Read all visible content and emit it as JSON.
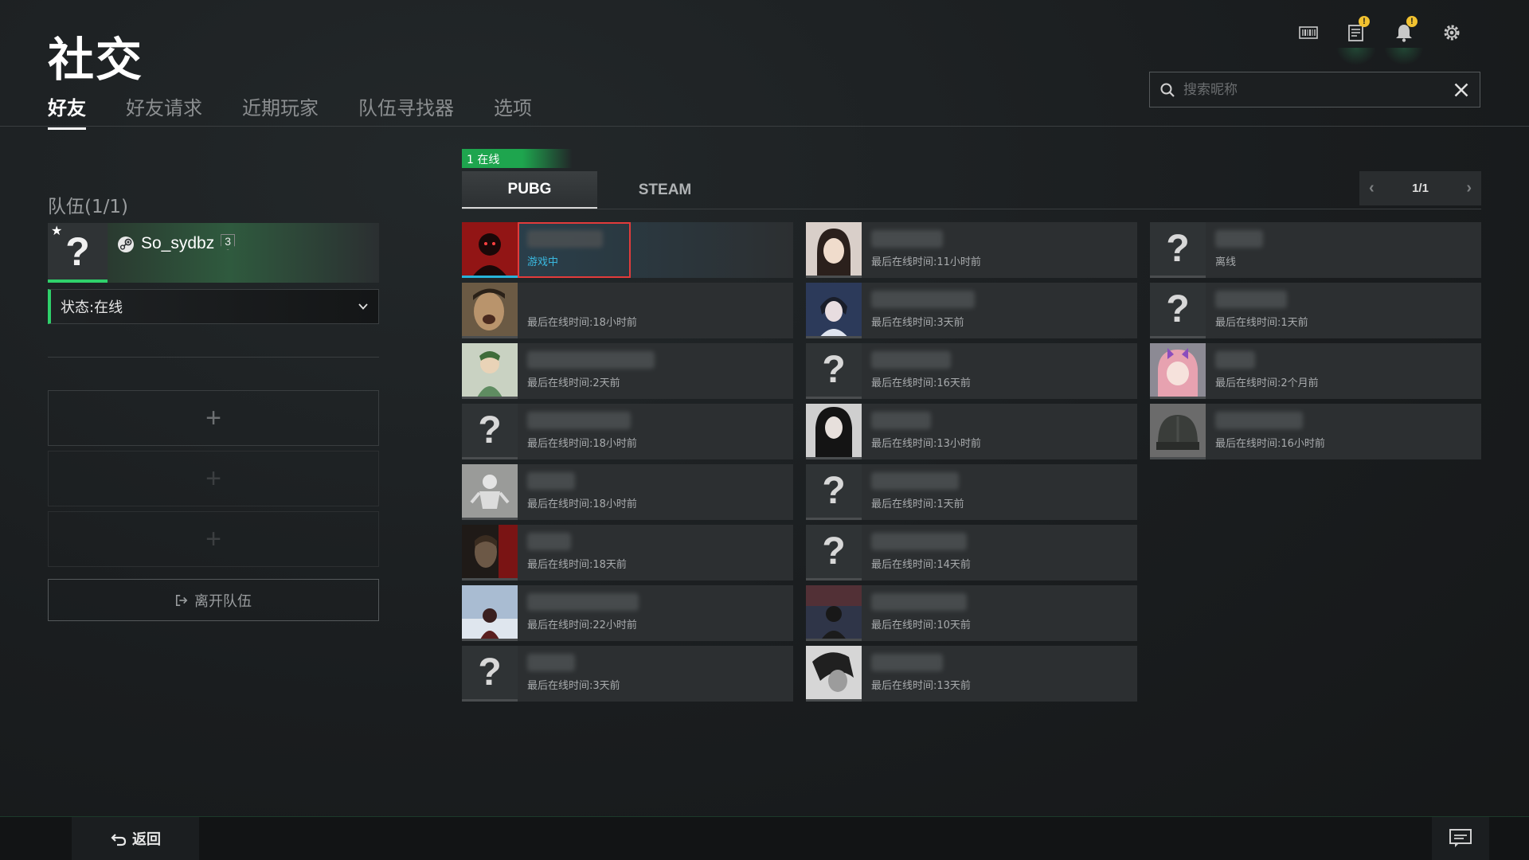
{
  "header": {
    "title": "社交",
    "tabs": [
      "好友",
      "好友请求",
      "近期玩家",
      "队伍寻找器",
      "选项"
    ],
    "search_placeholder": "搜索昵称"
  },
  "icons": {
    "alert": "!"
  },
  "team": {
    "title": "队伍(1/1)",
    "member_name": "So_sydbz",
    "member_level": "3",
    "status_label": "状态:在线",
    "leave_label": "离开队伍"
  },
  "friends": {
    "online_count": "1 在线",
    "platform_tabs": [
      "PUBG",
      "STEAM"
    ],
    "page": "1/1",
    "list": [
      {
        "status": "游戏中"
      },
      {
        "status": "最后在线时间:18小时前"
      },
      {
        "status": "最后在线时间:2天前"
      },
      {
        "status": "最后在线时间:18小时前"
      },
      {
        "status": "最后在线时间:18小时前"
      },
      {
        "status": "最后在线时间:18天前"
      },
      {
        "status": "最后在线时间:22小时前"
      },
      {
        "status": "最后在线时间:3天前"
      },
      {
        "status": "最后在线时间:11小时前"
      },
      {
        "status": "最后在线时间:3天前"
      },
      {
        "status": "最后在线时间:16天前"
      },
      {
        "status": "最后在线时间:13小时前"
      },
      {
        "status": "最后在线时间:1天前"
      },
      {
        "status": "最后在线时间:14天前"
      },
      {
        "status": "最后在线时间:10天前"
      },
      {
        "status": "最后在线时间:13天前"
      },
      {
        "status": "离线"
      },
      {
        "status": "最后在线时间:1天前"
      },
      {
        "status": "最后在线时间:2个月前"
      },
      {
        "status": "最后在线时间:16小时前"
      }
    ]
  },
  "footer": {
    "back_label": "返回"
  },
  "colors": {
    "accent_green": "#2fd16b",
    "ingame_blue": "#3ab9e0",
    "highlight_red": "#e23b3b"
  }
}
